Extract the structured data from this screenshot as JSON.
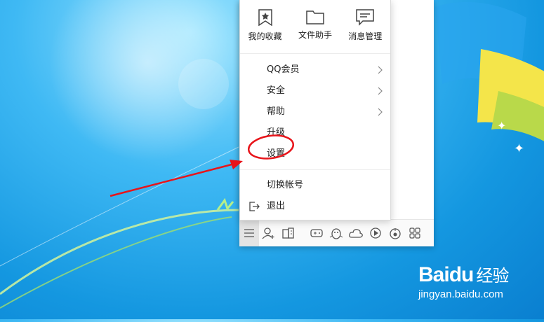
{
  "quick_actions": [
    {
      "label": "我的收藏",
      "icon": "star-bookmark-icon"
    },
    {
      "label": "文件助手",
      "icon": "folder-icon"
    },
    {
      "label": "消息管理",
      "icon": "chat-icon"
    }
  ],
  "menu": {
    "items": [
      {
        "label": "QQ会员",
        "has_submenu": true
      },
      {
        "label": "安全",
        "has_submenu": true
      },
      {
        "label": "帮助",
        "has_submenu": true
      },
      {
        "label": "升级",
        "has_submenu": false
      },
      {
        "label": "设置",
        "has_submenu": false
      }
    ],
    "bottom_items": [
      {
        "label": "切换帐号"
      },
      {
        "label": "退出",
        "icon": "logout-icon"
      }
    ]
  },
  "toolbar_icons": [
    "menu-icon",
    "add-contact-icon",
    "app-manager-icon",
    "game-icon",
    "penguin-icon",
    "cloud-icon",
    "video-play-icon",
    "music-icon",
    "apps-grid-icon"
  ],
  "watermark": {
    "logo_left": "Bai",
    "logo_paw": "du",
    "logo_cn": "经验",
    "url": "jingyan.baidu.com"
  },
  "colors": {
    "annotation": "#e8141a",
    "desktop": "#1a9be6"
  }
}
